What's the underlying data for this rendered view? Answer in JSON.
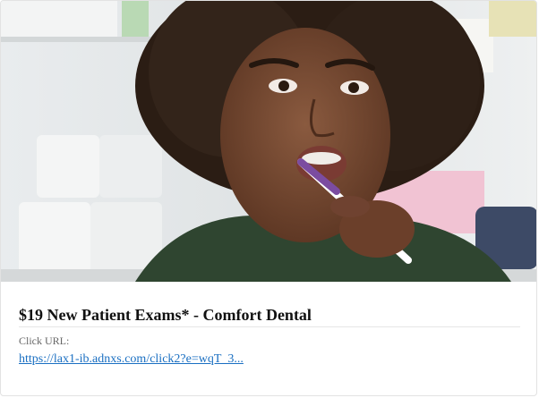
{
  "ad": {
    "title": "$19 New Patient Exams* - Comfort Dental",
    "url_label": "Click URL:",
    "url_text": "https://lax1-ib.adnxs.com/click2?e=wqT_3..."
  },
  "colors": {
    "link": "#1a6fc2",
    "title": "#111111",
    "label": "#666666"
  },
  "icons": {
    "image": "ad-photo-woman-brushing-teeth"
  }
}
